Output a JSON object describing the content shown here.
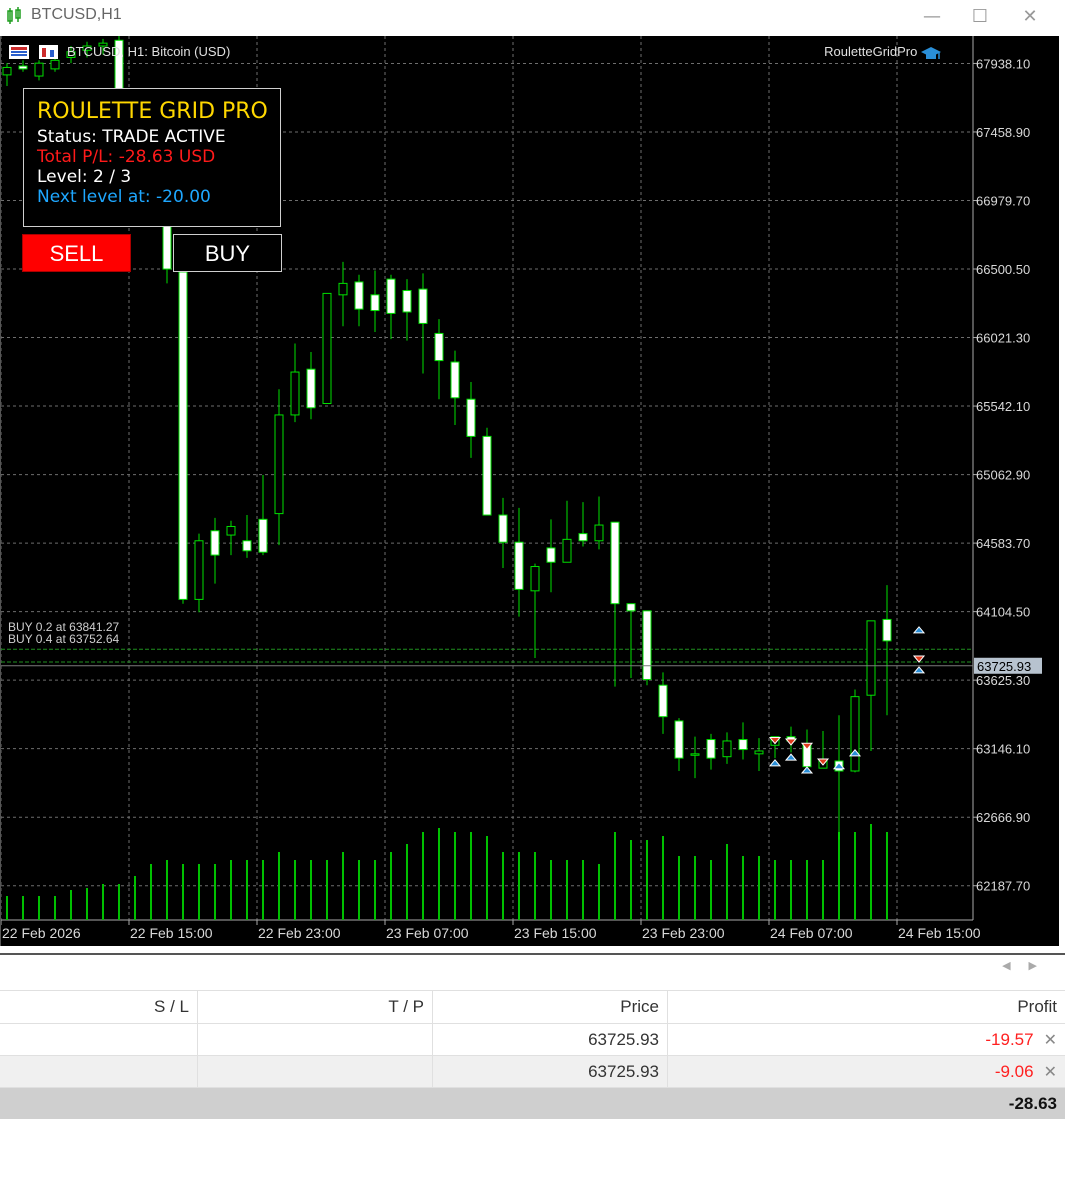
{
  "window": {
    "title": "BTCUSD,H1",
    "min": "—",
    "max": "☐",
    "close": "✕"
  },
  "chart": {
    "symbol_tf": "BTCUSD, H1:",
    "description": "Bitcoin (USD)",
    "expert_name": "RouletteGridPro",
    "current_price": "63725.93",
    "price_ticks": [
      "67938.10",
      "67458.90",
      "66979.70",
      "66500.50",
      "66021.30",
      "65542.10",
      "65062.90",
      "64583.70",
      "64104.50",
      "63625.30",
      "63146.10",
      "62666.90",
      "62187.70"
    ],
    "time_ticks": [
      "22 Feb 2026",
      "22 Feb 15:00",
      "22 Feb 23:00",
      "23 Feb 07:00",
      "23 Feb 15:00",
      "23 Feb 23:00",
      "24 Feb 07:00",
      "24 Feb 15:00"
    ],
    "position_lines": [
      {
        "label": "BUY 0.2 at 63841.27",
        "price": 63841.27
      },
      {
        "label": "BUY 0.4 at 63752.64",
        "price": 63752.64
      }
    ],
    "colors": {
      "background": "#000000",
      "grid": "#6e6e6e",
      "candle": "#00e000",
      "bull_body": "#000000",
      "bear_body": "#ffffff",
      "volume": "#00c000"
    }
  },
  "panel": {
    "title": "ROULETTE GRID PRO",
    "status": "Status: TRADE ACTIVE",
    "total_pl": "Total P/L: -28.63 USD",
    "level": "Level: 2 / 3",
    "next_level": "Next level at: -20.00"
  },
  "buttons": {
    "sell": "SELL",
    "buy": "BUY"
  },
  "table": {
    "headers": {
      "sl": "S / L",
      "tp": "T / P",
      "price": "Price",
      "profit": "Profit"
    },
    "rows": [
      {
        "price": "63725.93",
        "profit": "-19.57"
      },
      {
        "price": "63725.93",
        "profit": "-9.06"
      }
    ],
    "total": "-28.63"
  },
  "chart_data": {
    "type": "candlestick",
    "ylim": [
      61948,
      68130
    ],
    "candles": [
      [
        67858,
        67940,
        67780,
        67910
      ],
      [
        67920,
        67960,
        67880,
        67900
      ],
      [
        67850,
        67960,
        67820,
        67940
      ],
      [
        67900,
        67990,
        67880,
        67960
      ],
      [
        67980,
        68060,
        67940,
        68020
      ],
      [
        68030,
        68090,
        67980,
        68060
      ],
      [
        68060,
        68110,
        68000,
        68080
      ],
      [
        68100,
        68130,
        67580,
        67600
      ],
      [
        67480,
        67490,
        67290,
        67300
      ],
      [
        67440,
        67500,
        67260,
        67480
      ],
      [
        67440,
        67460,
        66400,
        66500
      ],
      [
        66480,
        66500,
        64160,
        64190
      ],
      [
        64190,
        64650,
        64100,
        64600
      ],
      [
        64670,
        64760,
        64300,
        64500
      ],
      [
        64640,
        64740,
        64500,
        64700
      ],
      [
        64600,
        64780,
        64480,
        64530
      ],
      [
        64750,
        65060,
        64500,
        64520
      ],
      [
        64790,
        65660,
        64570,
        65480
      ],
      [
        65480,
        65980,
        65430,
        65780
      ],
      [
        65800,
        65920,
        65450,
        65530
      ],
      [
        65560,
        66320,
        65560,
        66330
      ],
      [
        66320,
        66550,
        66100,
        66400
      ],
      [
        66410,
        66460,
        66100,
        66220
      ],
      [
        66320,
        66490,
        66060,
        66210
      ],
      [
        66430,
        66460,
        66010,
        66190
      ],
      [
        66350,
        66430,
        66000,
        66200
      ],
      [
        66360,
        66470,
        65770,
        66120
      ],
      [
        66050,
        66150,
        65590,
        65860
      ],
      [
        65850,
        65930,
        65410,
        65600
      ],
      [
        65590,
        65710,
        65180,
        65330
      ],
      [
        65330,
        65390,
        64940,
        64780
      ],
      [
        64780,
        64900,
        64410,
        64590
      ],
      [
        64590,
        64830,
        64070,
        64260
      ],
      [
        64250,
        64440,
        63780,
        64420
      ],
      [
        64550,
        64750,
        64240,
        64450
      ],
      [
        64450,
        64880,
        64460,
        64610
      ],
      [
        64650,
        64870,
        64560,
        64600
      ],
      [
        64600,
        64910,
        64540,
        64710
      ],
      [
        64730,
        64730,
        63580,
        64160
      ],
      [
        64160,
        64160,
        63640,
        64110
      ],
      [
        64110,
        64100,
        63590,
        63630
      ],
      [
        63590,
        63680,
        63250,
        63370
      ],
      [
        63340,
        63360,
        62990,
        63080
      ],
      [
        63100,
        63230,
        62940,
        63110
      ],
      [
        63210,
        63250,
        63000,
        63080
      ],
      [
        63090,
        63260,
        63040,
        63200
      ],
      [
        63210,
        63330,
        63070,
        63140
      ],
      [
        63110,
        63220,
        62990,
        63130
      ],
      [
        63170,
        63200,
        63080,
        63230
      ],
      [
        63230,
        63300,
        63120,
        63200
      ],
      [
        63170,
        63280,
        63020,
        63020
      ],
      [
        63010,
        63270,
        63060,
        63060
      ],
      [
        63060,
        63380,
        62510,
        62990
      ],
      [
        62990,
        63560,
        62980,
        63510
      ],
      [
        63520,
        64040,
        63130,
        64040
      ],
      [
        64050,
        64290,
        63380,
        63900
      ]
    ],
    "volumes": [
      12,
      12,
      12,
      12,
      15,
      16,
      18,
      18,
      22,
      28,
      30,
      28,
      28,
      28,
      30,
      30,
      30,
      34,
      30,
      30,
      30,
      34,
      30,
      30,
      34,
      38,
      44,
      46,
      44,
      44,
      42,
      34,
      34,
      34,
      30,
      30,
      30,
      28,
      44,
      40,
      40,
      42,
      32,
      32,
      30,
      38,
      32,
      32,
      30,
      30,
      30,
      30,
      44,
      44,
      48,
      44
    ]
  }
}
